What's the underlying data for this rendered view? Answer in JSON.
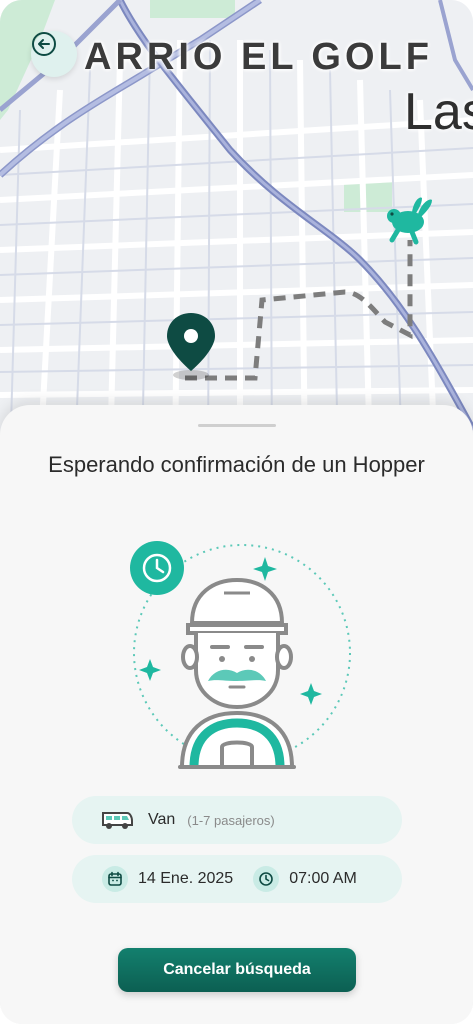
{
  "map": {
    "district_label": "ARRIO EL GOLF",
    "city_label": "Las",
    "back_icon": "arrow-left-icon",
    "origin_icon": "map-pin-icon",
    "driver_icon": "rabbit-icon",
    "accent_color": "#1fb8a0",
    "pin_color": "#0e4b43"
  },
  "sheet": {
    "title": "Esperando confirmación de un Hopper",
    "illustration": "driver-waiting-illustration",
    "vehicle": {
      "icon": "van-icon",
      "name": "Van",
      "capacity": "(1-7 pasajeros)"
    },
    "schedule": {
      "date_icon": "calendar-icon",
      "date": "14 Ene. 2025",
      "time_icon": "clock-icon",
      "time": "07:00 AM"
    },
    "cancel_label": "Cancelar búsqueda",
    "button_color": "#0f6f61"
  }
}
